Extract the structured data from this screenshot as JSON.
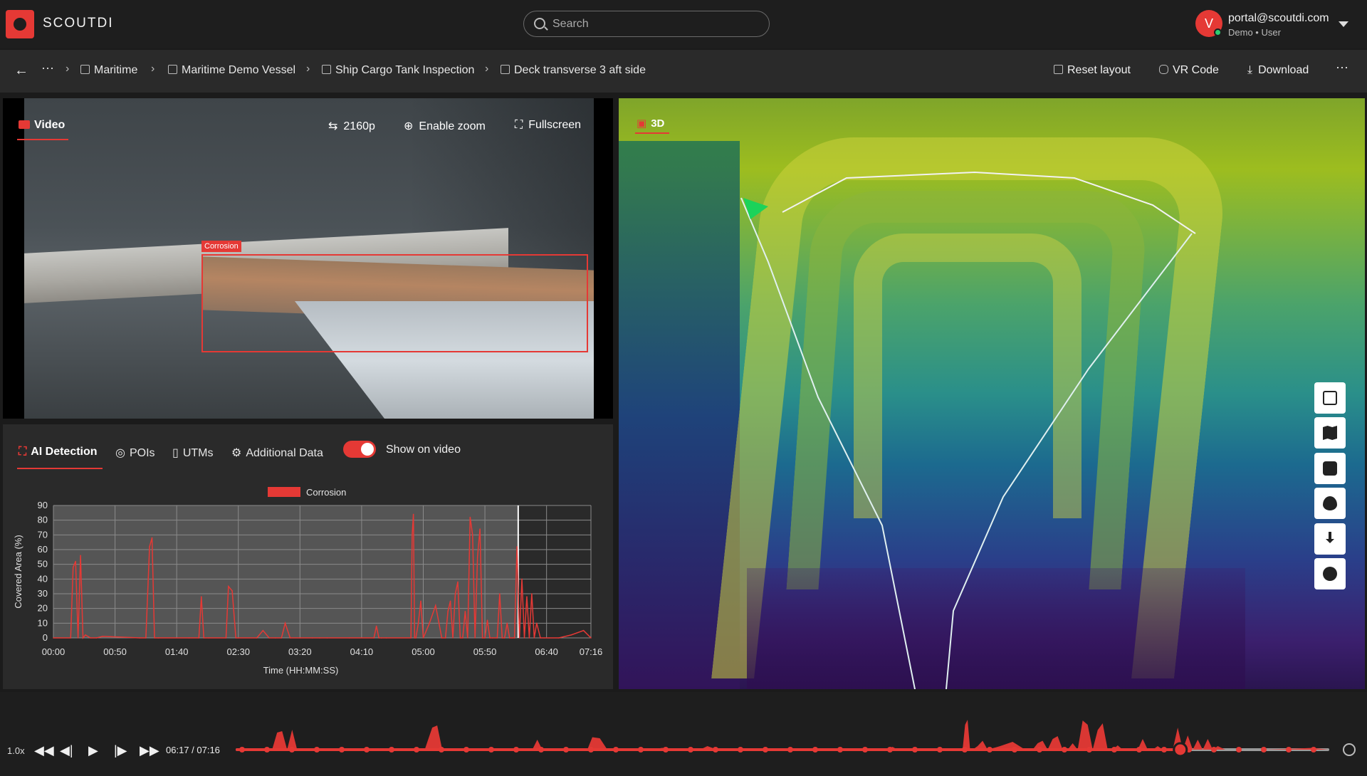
{
  "app": {
    "name": "SCOUTDI"
  },
  "search": {
    "placeholder": "Search"
  },
  "user": {
    "initial": "V",
    "email": "portal@scoutdi.com",
    "role": "Demo • User"
  },
  "breadcrumbs": [
    {
      "label": "Maritime",
      "icon": "archive-icon"
    },
    {
      "label": "Maritime Demo Vessel",
      "icon": "vessel-icon"
    },
    {
      "label": "Ship Cargo Tank Inspection",
      "icon": "document-icon"
    },
    {
      "label": "Deck transverse 3 aft side",
      "icon": "video-icon"
    }
  ],
  "actions": {
    "reset_layout": "Reset layout",
    "vr_code": "VR Code",
    "download": "Download"
  },
  "video": {
    "tab_label": "Video",
    "quality": "2160p",
    "enable_zoom": "Enable zoom",
    "fullscreen": "Fullscreen",
    "detection_label": "Corrosion"
  },
  "analysis": {
    "tabs": [
      "AI Detection",
      "POIs",
      "UTMs",
      "Additional Data"
    ],
    "show_on_video": "Show on video"
  },
  "view3d": {
    "tab_label": "3D"
  },
  "playback": {
    "speed": "1.0x",
    "time": "06:17 / 07:16"
  },
  "colors": {
    "accent": "#e53935",
    "panel": "#2a2a2a",
    "background": "#1b1b1b"
  },
  "chart_data": {
    "type": "line",
    "title": "",
    "legend": [
      "Corrosion"
    ],
    "xlabel": "Time (HH:MM:SS)",
    "ylabel": "Covered Area (%)",
    "ylim": [
      0,
      90
    ],
    "yticks": [
      0,
      10,
      20,
      30,
      40,
      50,
      60,
      70,
      80,
      90
    ],
    "xticks": [
      "00:00",
      "00:50",
      "01:40",
      "02:30",
      "03:20",
      "04:10",
      "05:00",
      "05:50",
      "06:40",
      "07:16"
    ],
    "xlim_seconds": [
      0,
      436
    ],
    "current_time_seconds": 377,
    "series": [
      {
        "name": "Corrosion",
        "color": "#e53935",
        "x": [
          0,
          14,
          16,
          18,
          20,
          22,
          24,
          26,
          30,
          35,
          40,
          70,
          75,
          78,
          80,
          82,
          85,
          110,
          118,
          120,
          122,
          126,
          140,
          142,
          145,
          148,
          150,
          165,
          170,
          175,
          180,
          185,
          188,
          192,
          200,
          210,
          216,
          222,
          240,
          260,
          262,
          264,
          266,
          270,
          290,
          291,
          292,
          293,
          294,
          296,
          298,
          300,
          305,
          310,
          315,
          318,
          320,
          322,
          324,
          326,
          328,
          330,
          332,
          334,
          336,
          338,
          340,
          342,
          344,
          346,
          348,
          350,
          352,
          354,
          356,
          360,
          362,
          364,
          366,
          368,
          370,
          372,
          374,
          376,
          378,
          380,
          382,
          384,
          386,
          388,
          390,
          392,
          395,
          398,
          402,
          410,
          420,
          430,
          436
        ],
        "y": [
          0,
          0,
          48,
          52,
          0,
          56,
          0,
          2,
          0,
          0,
          1,
          0,
          0,
          62,
          68,
          0,
          0,
          0,
          0,
          28,
          0,
          0,
          0,
          35,
          32,
          0,
          0,
          0,
          5,
          0,
          0,
          0,
          10,
          0,
          0,
          0,
          0,
          0,
          0,
          0,
          8,
          0,
          0,
          0,
          0,
          70,
          84,
          0,
          0,
          10,
          25,
          0,
          10,
          22,
          0,
          0,
          18,
          25,
          0,
          30,
          38,
          0,
          0,
          18,
          0,
          82,
          70,
          0,
          55,
          74,
          0,
          0,
          12,
          0,
          0,
          0,
          30,
          0,
          0,
          10,
          0,
          0,
          0,
          62,
          0,
          40,
          0,
          28,
          0,
          30,
          0,
          10,
          0,
          0,
          0,
          0,
          2,
          5,
          0
        ]
      }
    ]
  },
  "timeline_data": {
    "current_fraction": 0.865
  }
}
